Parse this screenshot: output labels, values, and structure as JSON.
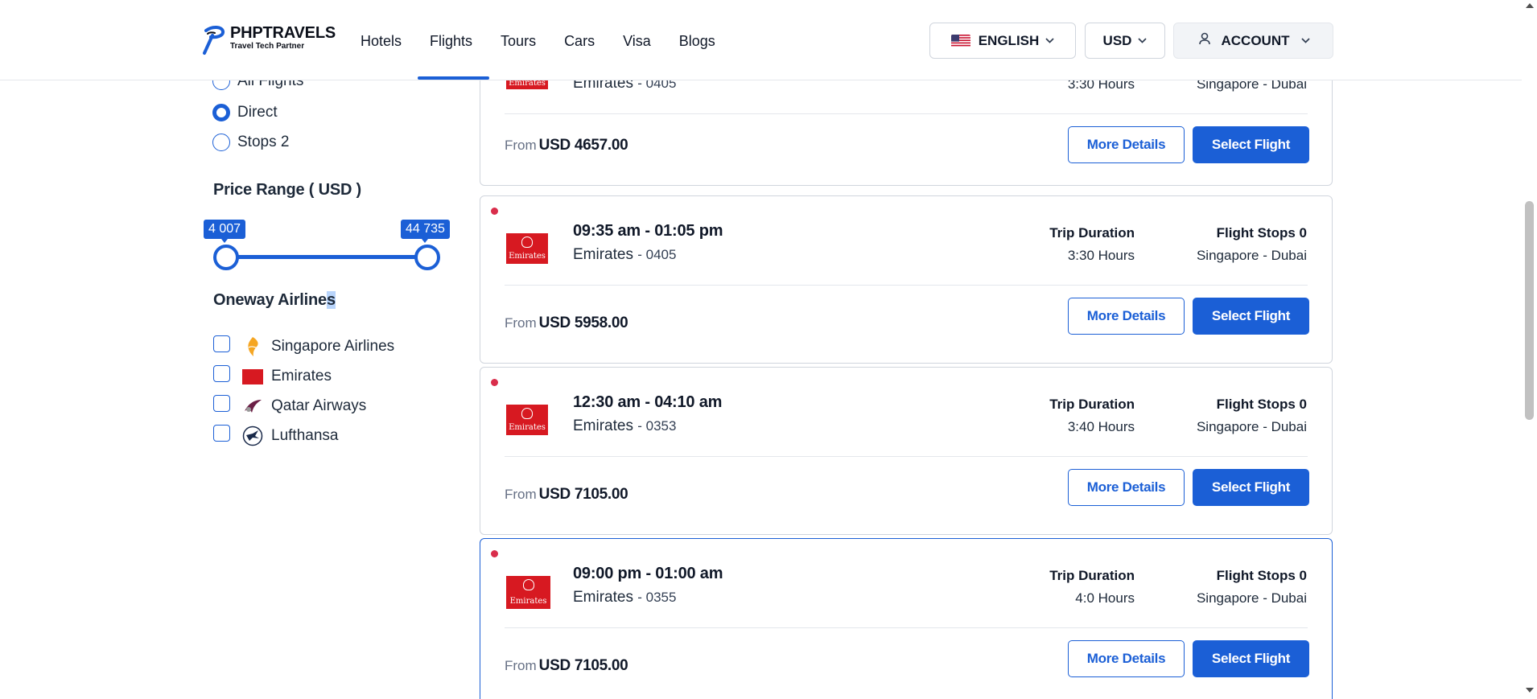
{
  "brand": {
    "name": "PHPTRAVELS",
    "tagline": "Travel Tech Partner",
    "accent": "#1b5fd6"
  },
  "nav": {
    "items": [
      {
        "label": "Hotels"
      },
      {
        "label": "Flights",
        "active": true
      },
      {
        "label": "Tours"
      },
      {
        "label": "Cars"
      },
      {
        "label": "Visa"
      },
      {
        "label": "Blogs"
      }
    ]
  },
  "header": {
    "language": "ENGLISH",
    "currency": "USD",
    "account": "ACCOUNT"
  },
  "filters": {
    "stops": [
      {
        "label": "All Flights",
        "selected": false
      },
      {
        "label": "Direct",
        "selected": true
      },
      {
        "label": "Stops 2",
        "selected": false
      }
    ],
    "price_range": {
      "title": "Price Range ( USD )",
      "min_label": "4 007",
      "max_label": "44 735"
    },
    "airlines": {
      "title_start": "Oneway Airline",
      "title_end": "s",
      "items": [
        {
          "label": "Singapore Airlines",
          "icon": "singapore-airlines-logo-icon",
          "checked": false
        },
        {
          "label": "Emirates",
          "icon": "emirates-logo-icon",
          "checked": false
        },
        {
          "label": "Qatar Airways",
          "icon": "qatar-airways-logo-icon",
          "checked": false
        },
        {
          "label": "Lufthansa",
          "icon": "lufthansa-logo-icon",
          "checked": false
        }
      ]
    }
  },
  "flights": [
    {
      "times": "",
      "airline": "Emirates",
      "code": "0405",
      "duration_label": "",
      "duration": "3:30 Hours",
      "stops_label": "",
      "route": "Singapore - Dubai",
      "from_label": "From",
      "price": "USD 4657.00",
      "more_label": "More Details",
      "select_label": "Select Flight",
      "logo_text": "Emirates"
    },
    {
      "times": "09:35 am - 01:05 pm",
      "airline": "Emirates",
      "code": "0405",
      "duration_label": "Trip Duration",
      "duration": "3:30 Hours",
      "stops_label": "Flight Stops 0",
      "route": "Singapore - Dubai",
      "from_label": "From",
      "price": "USD 5958.00",
      "more_label": "More Details",
      "select_label": "Select Flight",
      "logo_text": "Emirates"
    },
    {
      "times": "12:30 am - 04:10 am",
      "airline": "Emirates",
      "code": "0353",
      "duration_label": "Trip Duration",
      "duration": "3:40 Hours",
      "stops_label": "Flight Stops 0",
      "route": "Singapore - Dubai",
      "from_label": "From",
      "price": "USD 7105.00",
      "more_label": "More Details",
      "select_label": "Select Flight",
      "logo_text": "Emirates"
    },
    {
      "times": "09:00 pm - 01:00 am",
      "airline": "Emirates",
      "code": "0355",
      "duration_label": "Trip Duration",
      "duration": "4:0 Hours",
      "stops_label": "Flight Stops 0",
      "route": "Singapore - Dubai",
      "from_label": "From",
      "price": "USD 7105.00",
      "more_label": "More Details",
      "select_label": "Select Flight",
      "logo_text": "Emirates"
    }
  ]
}
